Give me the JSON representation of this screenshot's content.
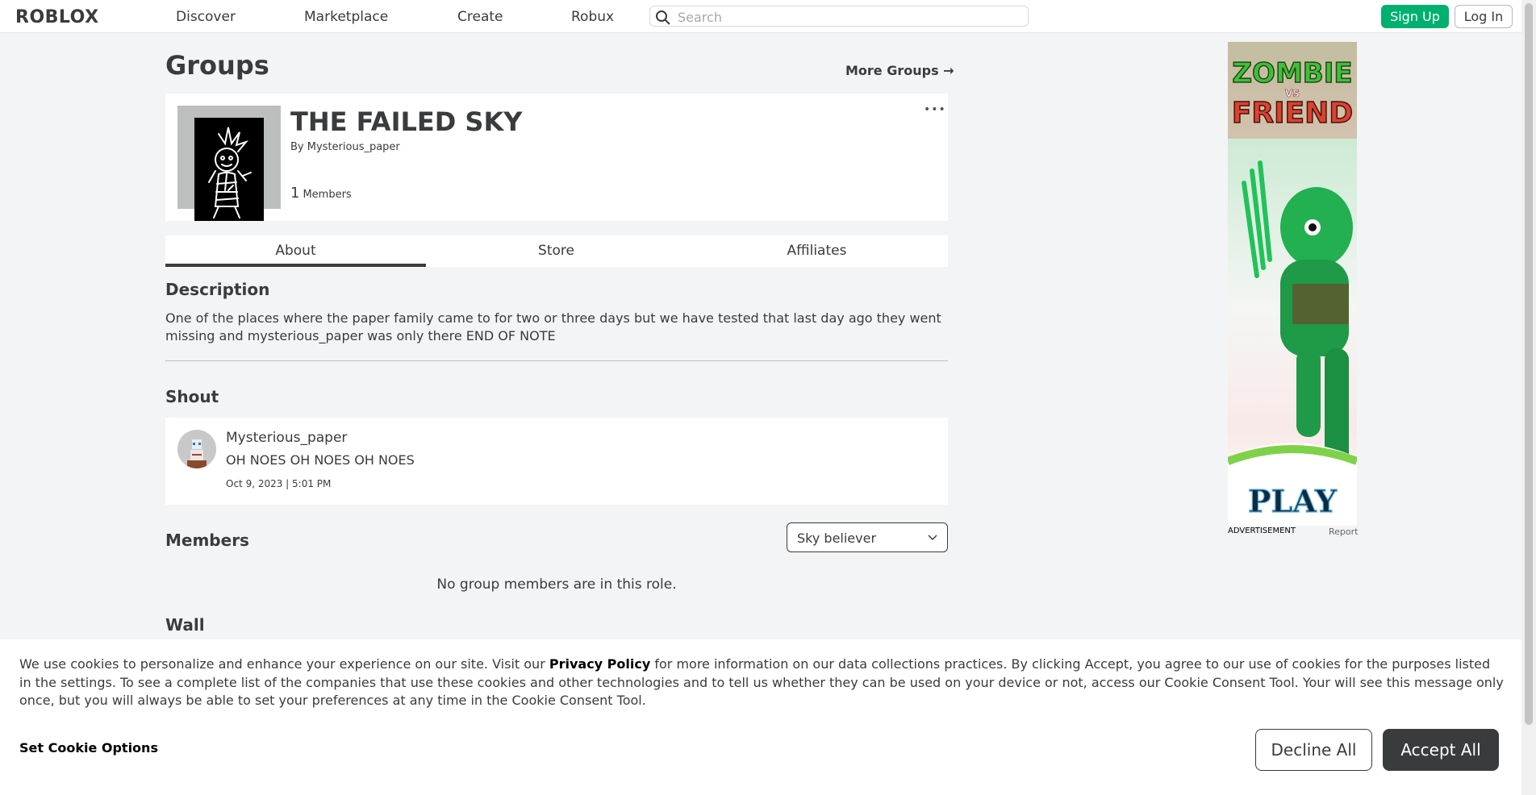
{
  "nav": {
    "logo": "ROBLOX",
    "links": [
      "Discover",
      "Marketplace",
      "Create",
      "Robux"
    ],
    "search_placeholder": "Search",
    "signup": "Sign Up",
    "login": "Log In"
  },
  "page": {
    "title": "Groups",
    "more_groups": "More Groups →"
  },
  "group": {
    "name": "THE FAILED SKY",
    "by_prefix": "By",
    "owner": "Mysterious_paper",
    "member_count": "1",
    "member_label": "Members",
    "more_menu": "•••"
  },
  "tabs": [
    "About",
    "Store",
    "Affiliates"
  ],
  "about": {
    "description_title": "Description",
    "description": "One of the places where the paper family came to for two or three days but we have tested that last day ago they went missing and mysterious_paper was only there END OF NOTE"
  },
  "shout": {
    "title": "Shout",
    "user": "Mysterious_paper",
    "text": "OH NOES OH NOES OH NOES",
    "date": "Oct 9, 2023 | 5:01 PM"
  },
  "members": {
    "title": "Members",
    "role": "Sky believer",
    "empty": "No group members are in this role."
  },
  "wall": {
    "title": "Wall"
  },
  "ad": {
    "title_line1": "ZOMBIE",
    "title_vs": "VS",
    "title_line2": "FRIEND",
    "cta": "PLAY",
    "label": "ADVERTISEMENT",
    "report": "Report"
  },
  "cookie": {
    "text_before": "We use cookies to personalize and enhance your experience on our site. Visit our ",
    "privacy_link": "Privacy Policy",
    "text_after": " for more information on our data collections practices. By clicking Accept, you agree to our use of cookies for the purposes listed in the settings. To see a complete list of the companies that use these cookies and other technologies and to tell us whether they can be used on your device or not, access our Cookie Consent Tool. Your will see this message only once, but you will always be able to set your preferences at any time in the Cookie Consent Tool.",
    "set_options": "Set Cookie Options",
    "decline": "Decline All",
    "accept": "Accept All"
  },
  "colors": {
    "brand_green": "#00b06f",
    "text_dark": "#393b3d",
    "page_bg": "#f2f4f5"
  }
}
